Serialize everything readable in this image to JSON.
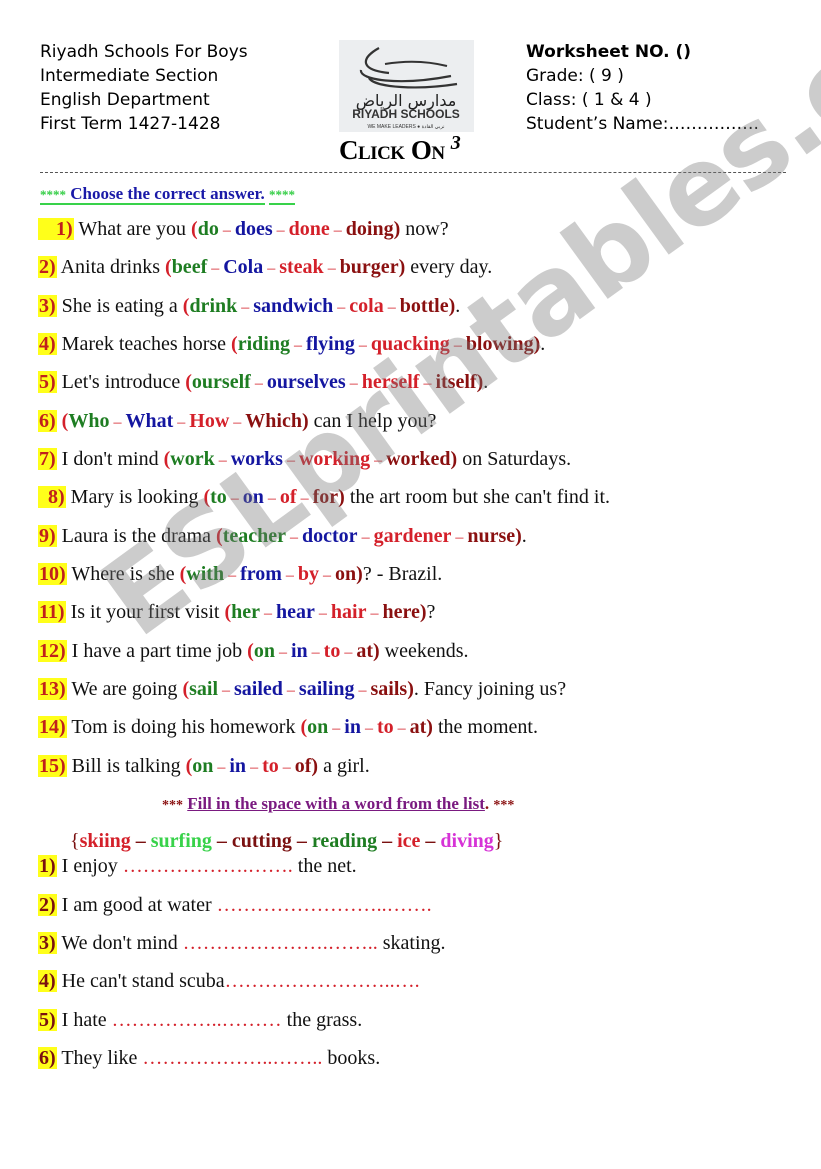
{
  "header": {
    "left_lines": [
      "Riyadh Schools For Boys",
      "Intermediate Section",
      "English Department",
      "First Term 1427-1428"
    ],
    "worksheet_no": "Worksheet NO. ()",
    "grade": "Grade: ( 9 )",
    "class": "Class: ( 1 & 4 )",
    "student_name": "Student’s Name:……………."
  },
  "logo": {
    "arabic": "مدارس الرياض",
    "english": "RIYADH SCHOOLS",
    "tagline": "WE MAKE LEADERS ● نربي القادة"
  },
  "click_on": {
    "text": "Click On",
    "sup": "3"
  },
  "section1": {
    "stars": "****",
    "title": "Choose the correct answer.",
    "questions": [
      {
        "num": "1)",
        "before": "What are you ",
        "options": [
          "do",
          "does",
          "done",
          "doing"
        ],
        "after": " now?"
      },
      {
        "num": "2)",
        "before": "Anita drinks ",
        "options": [
          "beef",
          "Cola",
          "steak",
          "burger"
        ],
        "after": " every day."
      },
      {
        "num": "3)",
        "before": "She is eating a ",
        "options": [
          "drink",
          "sandwich",
          "cola",
          "bottle"
        ],
        "after": "."
      },
      {
        "num": "4)",
        "before": "Marek teaches horse ",
        "options": [
          "riding",
          "flying",
          "quacking",
          "blowing"
        ],
        "after": "."
      },
      {
        "num": "5)",
        "before": "Let's introduce ",
        "options": [
          "ourself",
          "ourselves",
          "herself",
          "itself"
        ],
        "after": "."
      },
      {
        "num": "6)",
        "before": "",
        "options": [
          "Who",
          "What",
          "How",
          "Which"
        ],
        "after": " can I help you?"
      },
      {
        "num": "7)",
        "before": "I don't mind ",
        "options": [
          "work",
          "works",
          "working",
          "worked"
        ],
        "after": " on Saturdays."
      },
      {
        "num": "8)",
        "before": "Mary is looking ",
        "options": [
          "to",
          "on",
          "of",
          "for"
        ],
        "after": " the art room but she can't find it."
      },
      {
        "num": "9)",
        "before": "Laura is the drama ",
        "options": [
          "teacher",
          "doctor",
          "gardener",
          "nurse"
        ],
        "after": "."
      },
      {
        "num": "10)",
        "before": "Where is she ",
        "options": [
          "with",
          "from",
          "by",
          "on"
        ],
        "after": "? - Brazil."
      },
      {
        "num": "11)",
        "before": "Is it your first visit ",
        "options": [
          "her",
          "hear",
          "hair",
          "here"
        ],
        "after": "?"
      },
      {
        "num": "12)",
        "before": "I have a part time job ",
        "options": [
          "on",
          "in",
          "to",
          "at"
        ],
        "after": " weekends."
      },
      {
        "num": "13)",
        "before": "We are going ",
        "options": [
          "sail",
          "sailed",
          "sailing",
          "sails"
        ],
        "after": ". Fancy joining us?"
      },
      {
        "num": "14)",
        "before": "Tom is doing his homework ",
        "options": [
          "on",
          "in",
          "to",
          "at"
        ],
        "after": " the moment."
      },
      {
        "num": "15)",
        "before": "Bill is talking ",
        "options": [
          "on",
          "in",
          "to",
          "of"
        ],
        "after": " a girl."
      }
    ],
    "option_colors": [
      "#1e7d22",
      "#1416a0",
      "#d4202a",
      "#8a1010"
    ],
    "option_colors_q13": [
      "#1e7d22",
      "#1416a0",
      "#1416a0",
      "#8a1010"
    ]
  },
  "section2": {
    "stars_left": "***",
    "title": "Fill in the space with a word from the list",
    "title_end": ".",
    "stars_right": "***",
    "word_list": [
      "skiing",
      "surfing",
      "cutting",
      "reading",
      "ice",
      "diving"
    ],
    "word_colors": [
      "#d4202a",
      "#38d24a",
      "#7a1010",
      "#1e7d22",
      "#d4202a",
      "#d633d6"
    ],
    "questions": [
      {
        "num": "1)",
        "before": "I enjoy ",
        "blank": "……………….…….",
        "after": " the net."
      },
      {
        "num": "2)",
        "before": "I am good at water ",
        "blank": "……………………..…….",
        "after": ""
      },
      {
        "num": "3)",
        "before": "We don't mind ",
        "blank": "………………….……..",
        "after": " skating."
      },
      {
        "num": "4)",
        "before": "He can't stand scuba",
        "blank": "……………………..….",
        "after": ""
      },
      {
        "num": "5)",
        "before": "I hate ",
        "blank": "……………..………",
        "after": " the grass."
      },
      {
        "num": "6)",
        "before": "They like ",
        "blank": "………………..……..",
        "after": " books."
      }
    ]
  },
  "watermark": "ESLprintables.com"
}
